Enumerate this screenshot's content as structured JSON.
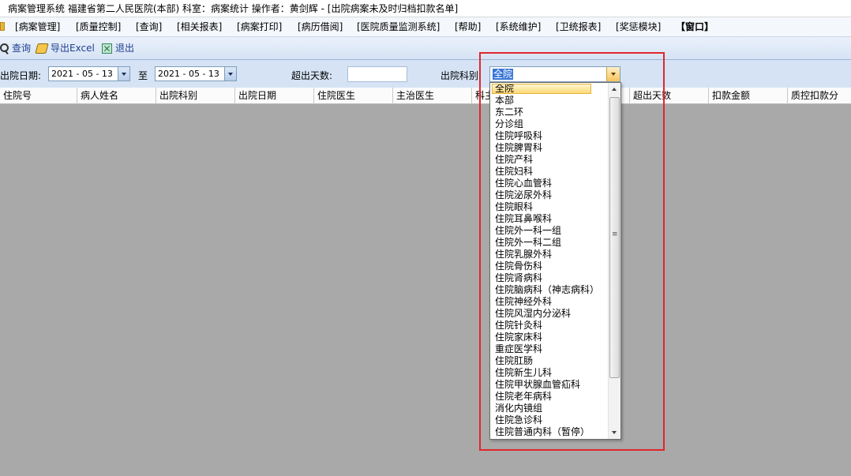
{
  "title": "病案管理系统  福建省第二人民医院(本部)  科室：病案统计 操作者：黄剑辉 - [出院病案未及时归档扣款名单]",
  "menu": [
    {
      "label": "[病案管理]"
    },
    {
      "label": "[质量控制]"
    },
    {
      "label": "[查询]"
    },
    {
      "label": "[相关报表]"
    },
    {
      "label": "[病案打印]"
    },
    {
      "label": "[病历借阅]"
    },
    {
      "label": "[医院质量监测系统]"
    },
    {
      "label": "[帮助]"
    },
    {
      "label": "[系统维护]"
    },
    {
      "label": "[卫统报表]"
    },
    {
      "label": "[奖惩模块]"
    },
    {
      "label": "【窗口】"
    }
  ],
  "toolbar": {
    "query_label": "查询",
    "export_label": "导出Excel",
    "exit_label": "退出"
  },
  "filters": {
    "discharge_date_label": "出院日期:",
    "date_from": "2021 - 05 - 13",
    "to_label": "至",
    "date_to": "2021 - 05 - 13",
    "overdue_days_label": "超出天数:",
    "overdue_days_value": "",
    "dept_label": "出院科别:",
    "dept_selected": "全院"
  },
  "columns": [
    {
      "label": "住院号"
    },
    {
      "label": "病人姓名"
    },
    {
      "label": "出院科别"
    },
    {
      "label": "出院日期"
    },
    {
      "label": "住院医生"
    },
    {
      "label": "主治医生"
    },
    {
      "label": "科主"
    },
    {
      "label": ""
    },
    {
      "label": "超出天数"
    },
    {
      "label": "扣款金额"
    },
    {
      "label": "质控扣款分"
    }
  ],
  "dropdown_items": [
    {
      "label": "全院"
    },
    {
      "label": "本部"
    },
    {
      "label": "东二环"
    },
    {
      "label": "分诊组"
    },
    {
      "label": "住院呼吸科"
    },
    {
      "label": "住院脾胃科"
    },
    {
      "label": "住院产科"
    },
    {
      "label": "住院妇科"
    },
    {
      "label": "住院心血管科"
    },
    {
      "label": "住院泌尿外科"
    },
    {
      "label": "住院眼科"
    },
    {
      "label": "住院耳鼻喉科"
    },
    {
      "label": "住院外一科一组"
    },
    {
      "label": "住院外一科二组"
    },
    {
      "label": "住院乳腺外科"
    },
    {
      "label": "住院骨伤科"
    },
    {
      "label": "住院肾病科"
    },
    {
      "label": "住院脑病科（神志病科）"
    },
    {
      "label": "住院神经外科"
    },
    {
      "label": "住院风湿内分泌科"
    },
    {
      "label": "住院针灸科"
    },
    {
      "label": "住院家床科"
    },
    {
      "label": "重症医学科"
    },
    {
      "label": "住院肛肠"
    },
    {
      "label": "住院新生儿科"
    },
    {
      "label": "住院甲状腺血管疝科"
    },
    {
      "label": "住院老年病科"
    },
    {
      "label": "消化内镜组"
    },
    {
      "label": "住院急诊科"
    },
    {
      "label": "住院普通内科（暂停）"
    }
  ],
  "colors": {
    "highlight_border": "#e0262d",
    "selection_blue": "#3875d7",
    "filterbar_bg": "#d5e3f5",
    "workspace_bg": "#a9a9a9"
  }
}
